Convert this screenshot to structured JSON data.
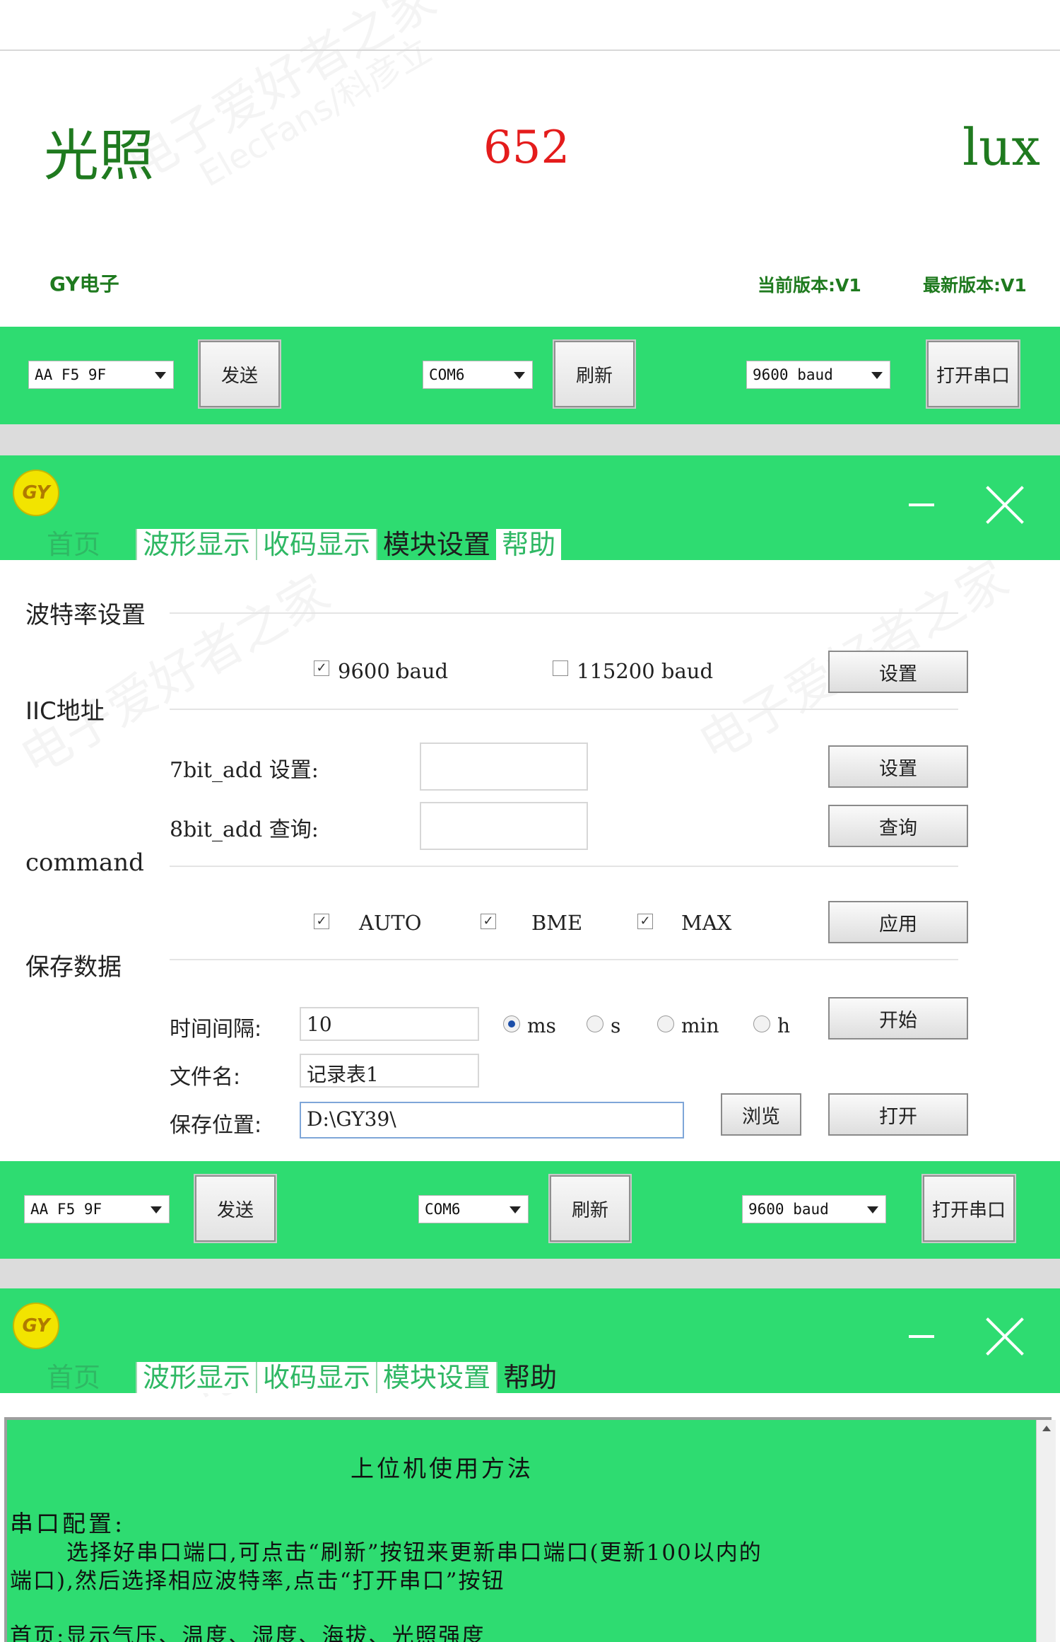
{
  "light": {
    "label": "光照",
    "value": "652",
    "unit": "lux"
  },
  "brand": {
    "name": "GY电子",
    "current_version": "当前版本:V1",
    "latest_version": "最新版本:V1"
  },
  "toolbar": {
    "command_value": "AA F5 9F",
    "send_label": "发送",
    "port_value": "COM6",
    "refresh_label": "刷新",
    "baud_value": "9600 baud",
    "open_port_label": "打开串口"
  },
  "window": {
    "logo_text": "GY",
    "tabs": [
      "首页",
      "波形显示",
      "收码显示",
      "模块设置",
      "帮助"
    ]
  },
  "settings": {
    "baud_section": "波特率设置",
    "baud_9600": "9600 baud",
    "baud_115200": "115200 baud",
    "baud_set_label": "设置",
    "iic_section": "IIC地址",
    "bit7_label": "7bit_add 设置:",
    "bit7_value": "",
    "bit7_set_label": "设置",
    "bit8_label": "8bit_add 查询:",
    "bit8_value": "",
    "bit8_query_label": "查询",
    "command_section": "command",
    "cmd_auto": "AUTO",
    "cmd_bme": "BME",
    "cmd_max": "MAX",
    "apply_label": "应用",
    "save_section": "保存数据",
    "interval_label": "时间间隔:",
    "interval_value": "10",
    "unit_ms": "ms",
    "unit_s": "s",
    "unit_min": "min",
    "unit_h": "h",
    "start_label": "开始",
    "filename_label": "文件名:",
    "filename_value": "记录表1",
    "location_label": "保存位置:",
    "location_value": "D:\\GY39\\",
    "browse_label": "浏览",
    "open_label": "打开"
  },
  "help": {
    "title": "上位机使用方法",
    "serial_heading": "串口配置:",
    "serial_text_1": "选择好串口端口,可点击“刷新”按钮来更新串口端口(更新100以内的",
    "serial_text_2": "端口),然后选择相应波特率,点击“打开串口”按钮",
    "home_text": "首页:显示气压、温度、湿度、海拔、光照强度"
  },
  "watermark": {
    "cn": "电子爱好者之家",
    "en": "ElecFans/科彦立"
  }
}
